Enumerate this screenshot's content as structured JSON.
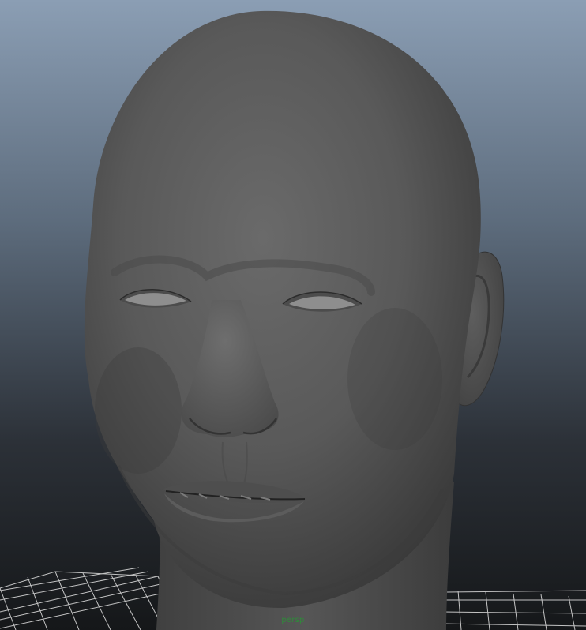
{
  "viewport": {
    "camera_label": "persp",
    "label_color": "#2f8a3a",
    "background_top_color": "#8a9db3",
    "background_bottom_color": "#16181b",
    "grid_color": "#d8d8d8",
    "model_color": "#5a5a5a"
  }
}
